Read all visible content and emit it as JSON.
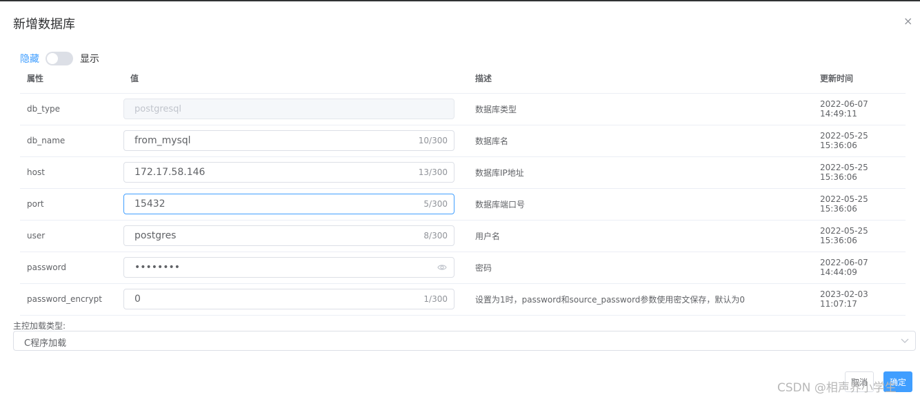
{
  "dialog": {
    "title": "新增数据库"
  },
  "toggle": {
    "left_label": "隐藏",
    "right_label": "显示"
  },
  "table": {
    "headers": [
      "属性",
      "值",
      "描述",
      "更新时间"
    ],
    "rows": [
      {
        "attr": "db_type",
        "value": "postgresql",
        "counter": "",
        "desc": "数据库类型",
        "time": "2022-06-07 14:49:11"
      },
      {
        "attr": "db_name",
        "value": "from_mysql",
        "counter": "10/300",
        "desc": "数据库名",
        "time": "2022-05-25 15:36:06"
      },
      {
        "attr": "host",
        "value": "172.17.58.146",
        "counter": "13/300",
        "desc": "数据库IP地址",
        "time": "2022-05-25 15:36:06"
      },
      {
        "attr": "port",
        "value": "15432",
        "counter": "5/300",
        "desc": "数据库端口号",
        "time": "2022-05-25 15:36:06"
      },
      {
        "attr": "user",
        "value": "postgres",
        "counter": "8/300",
        "desc": "用户名",
        "time": "2022-05-25 15:36:06"
      },
      {
        "attr": "password",
        "value": "••••••••",
        "counter": "",
        "desc": "密码",
        "time": "2022-06-07 14:44:09"
      },
      {
        "attr": "password_encrypt",
        "value": "0",
        "counter": "1/300",
        "desc": "设置为1时，password和source_password参数使用密文保存，默认为0",
        "time": "2023-02-03 11:07:17"
      }
    ]
  },
  "load_type": {
    "label": "主控加载类型:",
    "value": "C程序加载"
  },
  "footer": {
    "cancel_label": "取消",
    "ok_label": "确定",
    "watermark": "CSDN @相声界小学生"
  },
  "colors": {
    "accent": "#409eff",
    "border": "#dcdfe6"
  }
}
